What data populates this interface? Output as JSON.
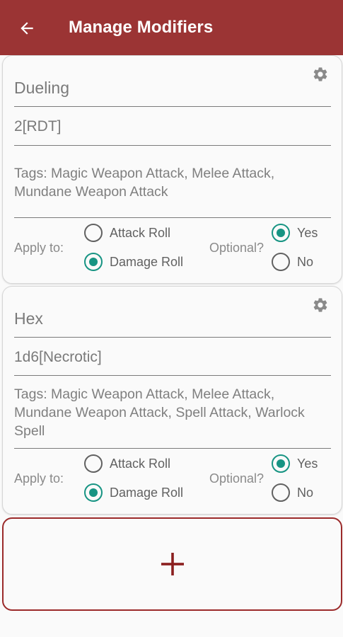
{
  "header": {
    "title": "Manage Modifiers"
  },
  "colors": {
    "brand": "#9b3434",
    "accent": "#179483",
    "add_border": "#9b2a2a"
  },
  "icons": {
    "back": "arrow-back-icon",
    "settings": "gear-icon",
    "add": "plus-icon"
  },
  "modifiers": [
    {
      "name": "Dueling",
      "dice": "2[RDT]",
      "tags": "Tags: Magic Weapon Attack, Melee Attack, Mundane Weapon Attack",
      "apply_label": "Apply to:",
      "attack_roll_label": "Attack Roll",
      "damage_roll_label": "Damage Roll",
      "apply_selected": "Damage Roll",
      "optional_label": "Optional?",
      "yes_label": "Yes",
      "no_label": "No",
      "optional_selected": "Yes"
    },
    {
      "name": "Hex",
      "dice": "1d6[Necrotic]",
      "tags": "Tags: Magic Weapon Attack, Melee Attack, Mundane Weapon Attack, Spell Attack, Warlock Spell",
      "apply_label": "Apply to:",
      "attack_roll_label": "Attack Roll",
      "damage_roll_label": "Damage Roll",
      "apply_selected": "Damage Roll",
      "optional_label": "Optional?",
      "yes_label": "Yes",
      "no_label": "No",
      "optional_selected": "Yes"
    }
  ]
}
